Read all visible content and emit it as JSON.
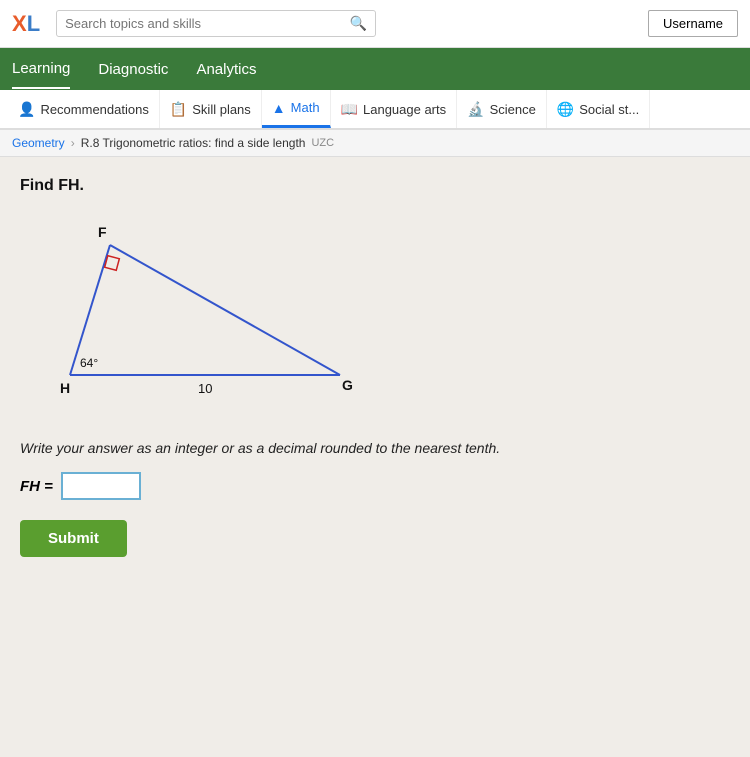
{
  "topbar": {
    "logo_x": "X",
    "logo_l": "L",
    "search_placeholder": "Search topics and skills",
    "username_label": "Username"
  },
  "green_nav": {
    "items": [
      {
        "id": "learning",
        "label": "Learning",
        "active": true
      },
      {
        "id": "diagnostic",
        "label": "Diagnostic",
        "active": false
      },
      {
        "id": "analytics",
        "label": "Analytics",
        "active": false
      }
    ]
  },
  "subject_tabs": {
    "items": [
      {
        "id": "recommendations",
        "label": "Recommendations",
        "icon": "👤",
        "active": false
      },
      {
        "id": "skill-plans",
        "label": "Skill plans",
        "icon": "📋",
        "active": false
      },
      {
        "id": "math",
        "label": "Math",
        "icon": "▲",
        "active": true
      },
      {
        "id": "language-arts",
        "label": "Language arts",
        "icon": "📖",
        "active": false
      },
      {
        "id": "science",
        "label": "Science",
        "icon": "🔬",
        "active": false
      },
      {
        "id": "social-studies",
        "label": "Social st...",
        "icon": "🌐",
        "active": false
      }
    ]
  },
  "breadcrumb": {
    "parent": "Geometry",
    "current": "R.8 Trigonometric ratios: find a side length",
    "code": "UZC"
  },
  "problem": {
    "title": "Find FH.",
    "instructions": "Write your answer as an integer or as a decimal rounded to the nearest tenth.",
    "answer_label": "FH =",
    "submit_label": "Submit"
  },
  "triangle": {
    "angle_label": "64°",
    "side_label": "10",
    "vertex_h": "H",
    "vertex_f": "F",
    "vertex_g": "G"
  }
}
